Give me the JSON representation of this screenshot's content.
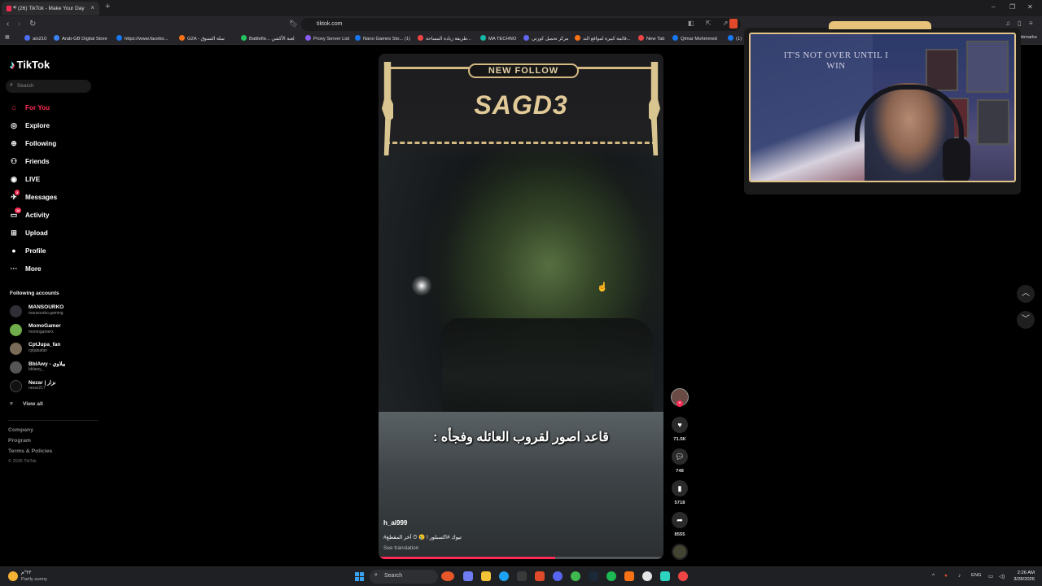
{
  "browser": {
    "tab_title": "(26) TikTok - Make Your Day",
    "url": "tiktok.com",
    "bookmarks": [
      {
        "label": "aio210",
        "color": "#4c6ef5"
      },
      {
        "label": "Arab-GB Digital Store",
        "color": "#3b82f6"
      },
      {
        "label": "https://www.facebo...",
        "color": "#1877f2"
      },
      {
        "label": "G2A - سلة التسوق",
        "color": "#f97316"
      },
      {
        "label": "Battlefie... لعبة الأكشن",
        "color": "#22c55e"
      },
      {
        "label": "Proxy Server List",
        "color": "#8b5cf6"
      },
      {
        "label": "Nano Games Sto... (1)",
        "color": "#1877f2"
      },
      {
        "label": "طريقة زيادة المساحة...",
        "color": "#ef4444"
      },
      {
        "label": "MA TECHNO",
        "color": "#14b8a6"
      },
      {
        "label": "مركز تحميل كورتي",
        "color": "#6366f1"
      },
      {
        "label": "قائمة كبيرة لمواقع الند...",
        "color": "#f97316"
      },
      {
        "label": "New Tab",
        "color": "#ef4444"
      },
      {
        "label": "Qimar Mohmmed",
        "color": "#1877f2"
      },
      {
        "label": "(1)",
        "color": "#1877f2"
      }
    ],
    "bookmarks_end": "okmarks"
  },
  "sidebar": {
    "logo": "TikTok",
    "search_placeholder": "Search",
    "nav": [
      {
        "label": "For You",
        "icon": "home-icon",
        "active": true
      },
      {
        "label": "Explore",
        "icon": "compass-icon"
      },
      {
        "label": "Following",
        "icon": "following-icon"
      },
      {
        "label": "Friends",
        "icon": "friends-icon"
      },
      {
        "label": "LIVE",
        "icon": "live-icon"
      },
      {
        "label": "Messages",
        "icon": "messages-icon",
        "badge": "2"
      },
      {
        "label": "Activity",
        "icon": "activity-icon",
        "badge": "16"
      },
      {
        "label": "Upload",
        "icon": "upload-icon"
      },
      {
        "label": "Profile",
        "icon": "profile-icon"
      },
      {
        "label": "More",
        "icon": "more-icon"
      }
    ],
    "following_title": "Following accounts",
    "accounts": [
      {
        "name": "MANSOURKO",
        "handle": "mansourko.gaming"
      },
      {
        "name": "MomoGamer",
        "handle": "momogamerx"
      },
      {
        "name": "CptJupa_fan",
        "handle": "cptjubafan"
      },
      {
        "name": "BblAwy - بيلاوي",
        "handle": "bblawy_"
      },
      {
        "name": "Nezar | نزار",
        "handle": "nezar217"
      }
    ],
    "view_all": "View all",
    "footer": [
      "Company",
      "Program",
      "Terms & Policies"
    ],
    "copyright": "© 2026 TikTok"
  },
  "video": {
    "overlay_pill": "NEW FOLLOW",
    "overlay_name": "SAGD3",
    "caption": "قاعد اصور لقروب العائله وفجأه :",
    "author": "h_ai999",
    "description": "#تيوك #اكسبلور ! 😢 ⏱ آخر المقطع",
    "see_translation": "See translation",
    "progress": 0.62
  },
  "actions": {
    "likes": "71.5K",
    "comments": "748",
    "saves": "5718",
    "shares": "8555"
  },
  "webcam": {
    "wall_text": "IT'S NOT OVER UNTIL I WIN"
  },
  "taskbar": {
    "temp": "٢٢°م",
    "weather": "Partly sunny",
    "search": "Search",
    "lang": "ENG",
    "time": "2:26 AM",
    "date": "3/28/2026"
  }
}
